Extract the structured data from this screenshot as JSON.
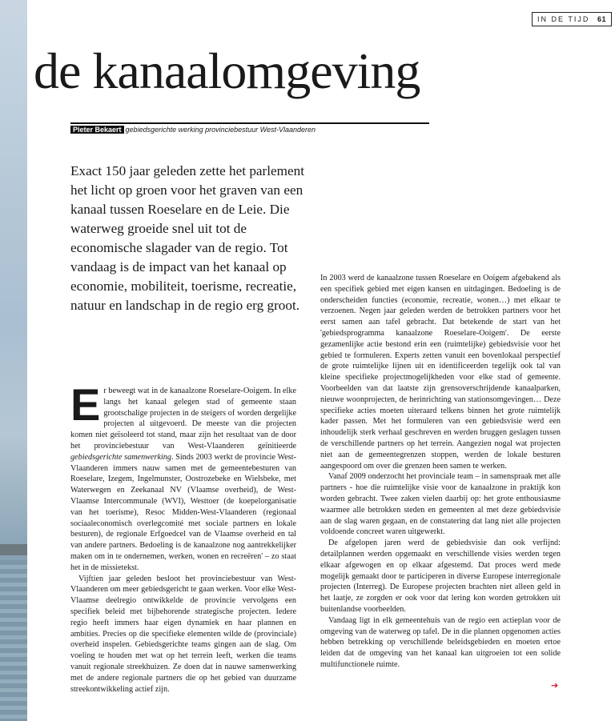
{
  "header": {
    "section": "IN DE TIJD",
    "page_number": "61"
  },
  "title": "de kanaalomgeving",
  "byline": {
    "author": "Pieter Bekaert",
    "role": "gebiedsgerichte werking provinciebestuur West-Vlaanderen"
  },
  "lead": "Exact 150 jaar geleden zette het parlement het licht op groen voor het graven van een kanaal tussen Roeselare en de Leie. Die waterweg groeide snel uit tot de economische slagader van de regio. Tot vandaag is de impact van het kanaal op economie, mobiliteit, toerisme, recreatie, natuur en landschap in de regio erg groot.",
  "body_left": {
    "dropcap": "E",
    "p1_a": "r beweegt wat in de kanaalzone Roeselare-Ooigem. In elke langs het kanaal gelegen stad of gemeente staan grootschalige projecten in de steigers of worden dergelijke projecten al uitgevoerd. De meeste van die projecten komen niet geïsoleerd tot stand, maar zijn het resultaat van de door het provinciebestuur van West-Vlaanderen geïnitieerde ",
    "p1_em": "gebiedsgerichte samenwerking",
    "p1_b": ". Sinds 2003 werkt de provincie West-Vlaanderen immers nauw samen met de gemeentebesturen van Roeselare, Izegem, Ingelmunster, Oostrozebeke en Wielsbeke, met Waterwegen en Zeekanaal NV (Vlaamse overheid), de West-Vlaamse Intercommunale (WVI), Westtoer (de koepelorganisatie van het toerisme), Resoc Midden-West-Vlaanderen (regionaal sociaaleconomisch overlegcomité met sociale partners en lokale besturen), de regionale Erfgoedcel van de Vlaamse overheid en tal van andere partners. Bedoeling is de kanaalzone nog aantrekkelijker maken om in te ondernemen, werken, wonen en recreëren' – zo staat het in de missietekst.",
    "p2": "Vijftien jaar geleden besloot het provinciebestuur van West-Vlaanderen om meer gebiedsgericht te gaan werken. Voor elke West-Vlaamse deelregio ontwikkelde de provincie vervolgens een specifiek beleid met bijbehorende strategische projecten. Iedere regio heeft immers haar eigen dynamiek en haar plannen en ambities. Precies op die specifieke elementen wilde de (provinciale) overheid inspelen. Gebiedsgerichte teams gingen aan de slag. Om voeling te houden met wat op het terrein leeft, werken die teams vanuit regionale streekhuizen. Ze doen dat in nauwe samenwerking met de andere regionale partners die op het gebied van duurzame streekontwikkeling actief zijn."
  },
  "body_right": {
    "p1": "In 2003 werd de kanaalzone tussen Roeselare en Ooigem afgebakend als een specifiek gebied met eigen kansen en uitdagingen. Bedoeling is de onderscheiden functies (economie, recreatie, wonen…) met elkaar te verzoenen. Negen jaar geleden werden de betrokken partners voor het eerst samen aan tafel gebracht. Dat betekende de start van het 'gebiedsprogramma kanaalzone Roeselare-Ooigem'. De eerste gezamenlijke actie bestond erin een (ruimtelijke) gebiedsvisie voor het gebied te formuleren. Experts zetten vanuit een bovenlokaal perspectief de grote ruimtelijke lijnen uit en identificeerden tegelijk ook tal van kleine specifieke projectmogelijkheden voor elke stad of gemeente. Voorbeelden van dat laatste zijn grensoverschrijdende kanaalparken, nieuwe woonprojecten, de herinrichting van stationsomgevingen… Deze specifieke acties moeten uiteraard telkens binnen het grote ruimtelijk kader passen. Met het formuleren van een gebiedsvisie werd een inhoudelijk sterk verhaal geschreven en werden bruggen geslagen tussen de verschillende partners op het terrein. Aangezien nogal wat projecten niet aan de gemeentegrenzen stoppen, werden de lokale besturen aangespoord om over die grenzen heen samen te werken.",
    "p2": "Vanaf 2009 onderzocht het provinciale team – in samenspraak met alle partners - hoe die ruimtelijke visie voor de kanaalzone in praktijk kon worden gebracht. Twee zaken vielen daarbij op: het grote enthousiasme waarmee alle betrokken steden en gemeenten al met deze gebiedsvisie aan de slag waren gegaan, en de constatering dat lang niet alle projecten voldoende concreet waren uitgewerkt.",
    "p3": "De afgelopen jaren werd de gebiedsvisie dan ook verfijnd: detailplannen werden opgemaakt en verschillende visies werden tegen elkaar afgewogen en op elkaar afgestemd. Dat proces werd mede mogelijk gemaakt door te participeren in diverse Europese interregionale projecten (Interreg). De Europese projecten brachten niet alleen geld in het laatje, ze zorgden er ook voor dat lering kon worden getrokken uit buitenlandse voorbeelden.",
    "p4": "Vandaag ligt in elk gemeentehuis van de regio een actieplan voor de omgeving van de waterweg op tafel. De in die plannen opgenomen acties hebben betrekking op verschillende beleidsgebieden en moeten ertoe leiden dat de omgeving van het kanaal kan uitgroeien tot een solide multifunctionele ruimte."
  },
  "continue_arrow": "➔",
  "colors": {
    "accent": "#d0202b",
    "rule": "#111111"
  }
}
